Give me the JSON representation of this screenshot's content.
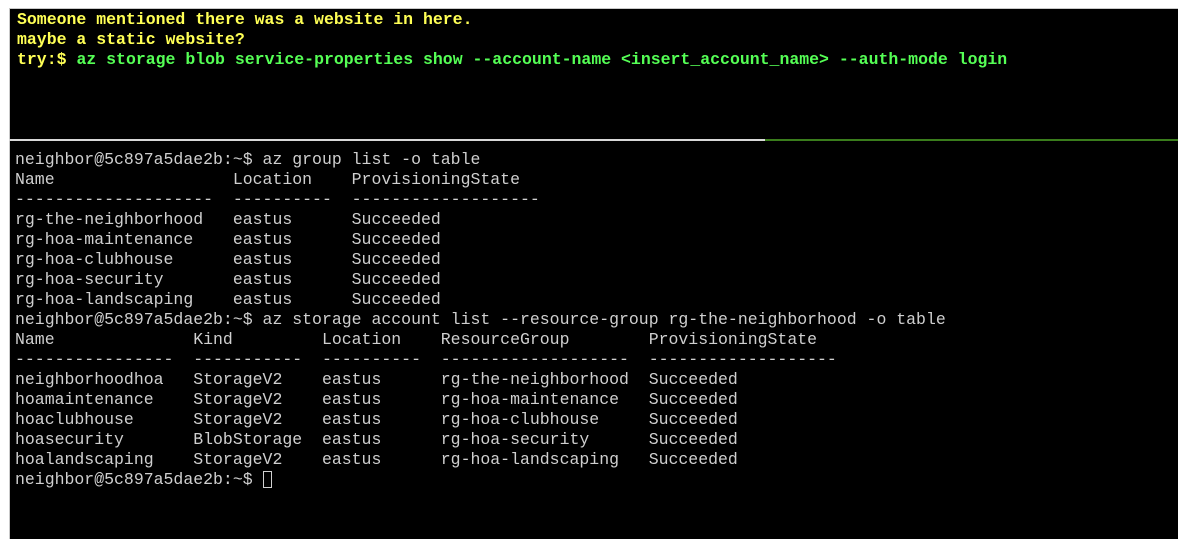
{
  "colors": {
    "background": "#000000",
    "hint_yellow": "#ffff55",
    "hint_green": "#55ff55",
    "output_text": "#cfcfcf",
    "divider_green": "#3a7d1c"
  },
  "hint": {
    "line1": "Someone mentioned there was a website in here.",
    "line2": "maybe a static website?",
    "try_label": "try",
    "try_prompt_suffix": ":$ ",
    "try_command": "az storage blob service-properties show --account-name <insert_account_name> --auth-mode login"
  },
  "terminal": {
    "lines": [
      "neighbor@5c897a5dae2b:~$ az group list -o table",
      "Name                  Location    ProvisioningState",
      "--------------------  ----------  -------------------",
      "rg-the-neighborhood   eastus      Succeeded",
      "rg-hoa-maintenance    eastus      Succeeded",
      "rg-hoa-clubhouse      eastus      Succeeded",
      "rg-hoa-security       eastus      Succeeded",
      "rg-hoa-landscaping    eastus      Succeeded",
      "neighbor@5c897a5dae2b:~$ az storage account list --resource-group rg-the-neighborhood -o table",
      "Name              Kind         Location    ResourceGroup        ProvisioningState",
      "----------------  -----------  ----------  -------------------  -------------------",
      "neighborhoodhoa   StorageV2    eastus      rg-the-neighborhood  Succeeded",
      "hoamaintenance    StorageV2    eastus      rg-hoa-maintenance   Succeeded",
      "hoaclubhouse      StorageV2    eastus      rg-hoa-clubhouse     Succeeded",
      "hoasecurity       BlobStorage  eastus      rg-hoa-security      Succeeded",
      "hoalandscaping    StorageV2    eastus      rg-hoa-landscaping   Succeeded"
    ],
    "prompt": "neighbor@5c897a5dae2b:~$ "
  }
}
